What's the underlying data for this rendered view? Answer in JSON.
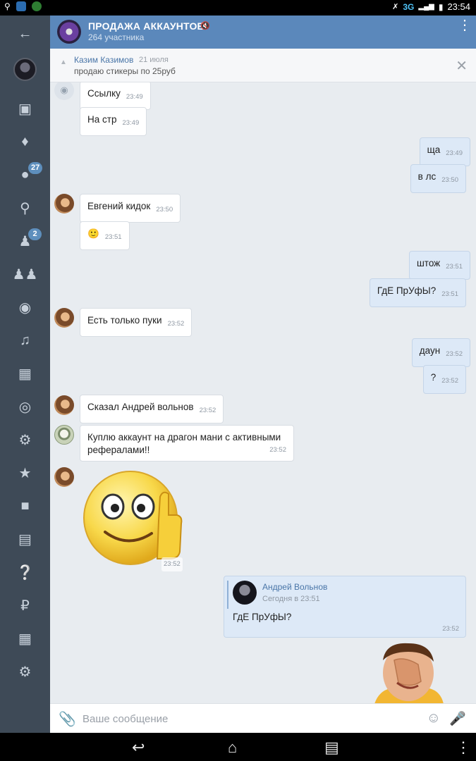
{
  "status_bar": {
    "network": "3G",
    "time": "23:54"
  },
  "sidebar": {
    "items": [
      {
        "icon": "back-arrow-icon",
        "badge": ""
      },
      {
        "icon": "news-icon",
        "badge": ""
      },
      {
        "icon": "bell-icon",
        "badge": ""
      },
      {
        "icon": "messages-icon",
        "badge": "27"
      },
      {
        "icon": "search-icon",
        "badge": ""
      },
      {
        "icon": "friends-icon",
        "badge": "2"
      },
      {
        "icon": "groups-icon",
        "badge": ""
      },
      {
        "icon": "camera-icon",
        "badge": ""
      },
      {
        "icon": "music-icon",
        "badge": ""
      },
      {
        "icon": "film-icon",
        "badge": ""
      },
      {
        "icon": "target-icon",
        "badge": ""
      },
      {
        "icon": "gamepad-icon",
        "badge": ""
      },
      {
        "icon": "star-icon",
        "badge": ""
      },
      {
        "icon": "document-icon",
        "badge": ""
      },
      {
        "icon": "wallet-icon",
        "badge": ""
      },
      {
        "icon": "help-icon",
        "badge": ""
      },
      {
        "icon": "ruble-icon",
        "badge": ""
      },
      {
        "icon": "apps-icon",
        "badge": ""
      },
      {
        "icon": "gear-icon",
        "badge": ""
      }
    ]
  },
  "header": {
    "title": "ПРОДАЖА АККАУНТОВ.",
    "subtitle": "264 участника"
  },
  "pinned": {
    "author": "Казим Казимов",
    "date": "21 июля",
    "text": "продаю стикеры по 25руб"
  },
  "messages": [
    {
      "text": "Ссылку",
      "time": "23:49"
    },
    {
      "text": "На стр",
      "time": "23:49"
    },
    {
      "text": "ща",
      "time": "23:49"
    },
    {
      "text": "в лс",
      "time": "23:50"
    },
    {
      "text": "Евгений кидок",
      "time": "23:50"
    },
    {
      "text": "🙂",
      "time": "23:51"
    },
    {
      "text": "штож",
      "time": "23:51"
    },
    {
      "text": "ГдЕ ПрУфЫ?",
      "time": "23:51"
    },
    {
      "text": "Есть только пуки",
      "time": "23:52"
    },
    {
      "text": "даун",
      "time": "23:52"
    },
    {
      "text": "?",
      "time": "23:52"
    },
    {
      "text": "Сказал Андрей вольнов",
      "time": "23:52"
    },
    {
      "text": "Куплю аккаунт на драгон мани с активными рефералами!!",
      "time": "23:52"
    },
    {
      "text": "",
      "time": "23:52"
    }
  ],
  "reply": {
    "author": "Андрей Вольнов",
    "time": "Сегодня в 23:51",
    "text": "ГдЕ ПрУфЫ?",
    "msg_time": "23:52"
  },
  "composer": {
    "placeholder": "Ваше сообщение"
  },
  "colors": {
    "header": "#5b88bb",
    "sidebar": "#3e4a57",
    "outgoing": "#dde9f7",
    "badge": "#5e8fbd"
  }
}
